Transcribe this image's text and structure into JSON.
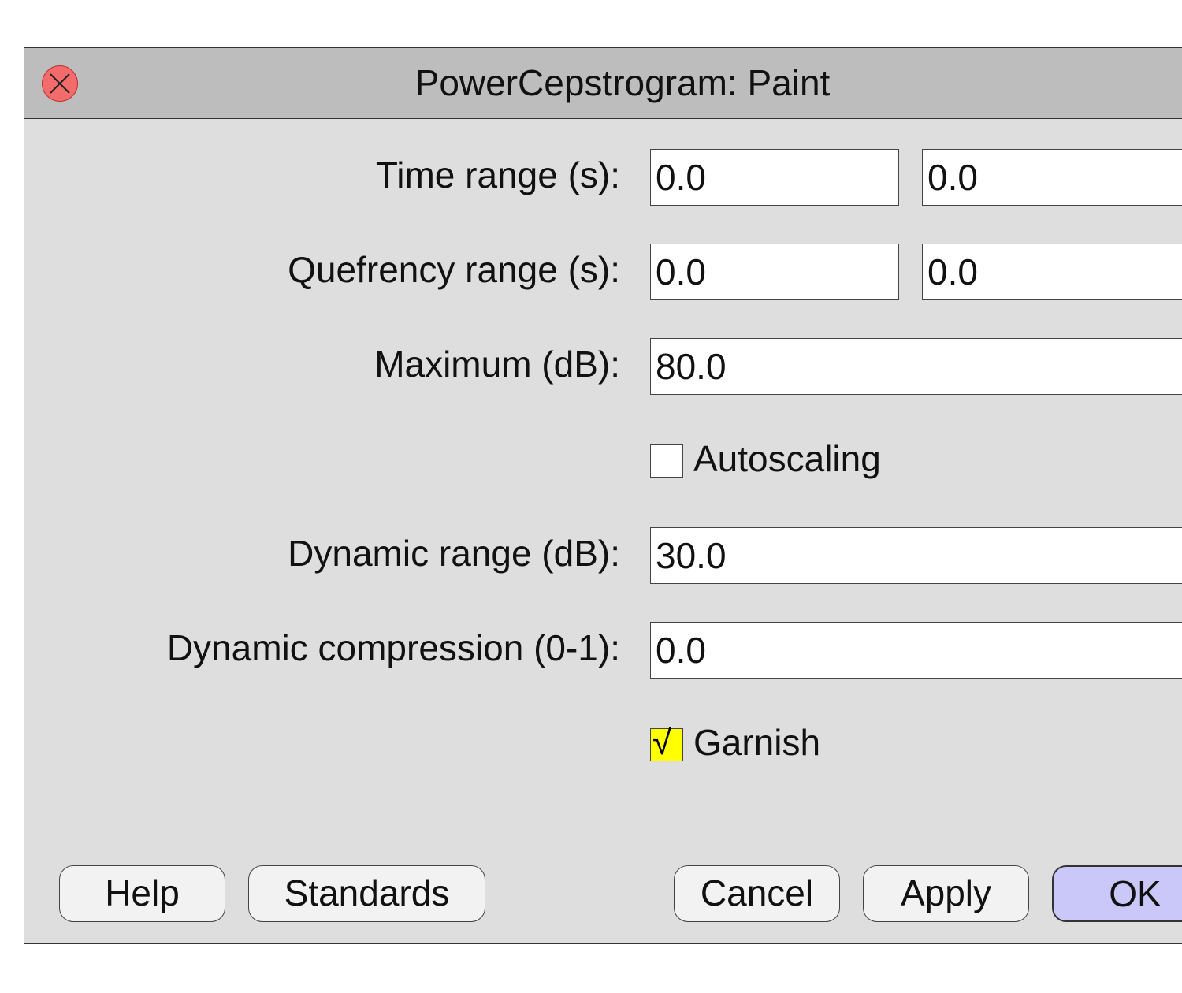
{
  "window": {
    "title": "PowerCepstrogram: Paint"
  },
  "fields": {
    "time_range": {
      "label": "Time range (s):",
      "from": "0.0",
      "to": "0.0"
    },
    "quefrency_range": {
      "label": "Quefrency range (s):",
      "from": "0.0",
      "to": "0.0"
    },
    "maximum": {
      "label": "Maximum (dB):",
      "value": "80.0"
    },
    "autoscaling": {
      "label": "Autoscaling",
      "checked": false
    },
    "dynamic_range": {
      "label": "Dynamic range (dB):",
      "value": "30.0"
    },
    "dynamic_compression": {
      "label": "Dynamic compression (0-1):",
      "value": "0.0"
    },
    "garnish": {
      "label": "Garnish",
      "checked": true,
      "mark": "√"
    }
  },
  "buttons": {
    "help": "Help",
    "standards": "Standards",
    "cancel": "Cancel",
    "apply": "Apply",
    "ok": "OK"
  },
  "colors": {
    "dialog_bg": "#dedede",
    "titlebar_bg": "#bdbdbd",
    "close_button": "#f36b6b",
    "checked_box": "#ffff00",
    "default_button": "#c9c8f8"
  }
}
